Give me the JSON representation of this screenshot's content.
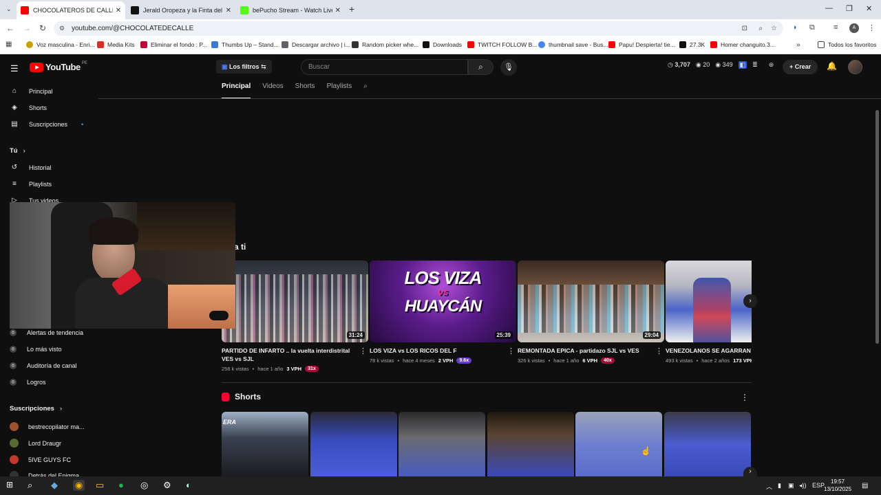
{
  "browser": {
    "tabs": [
      {
        "title": "CHOCOLATEROS DE CALLE - Yo",
        "active": true,
        "icon": "youtube-favicon",
        "color": "#ff0000"
      },
      {
        "title": "Jerald Oropeza y la Finta del Sh",
        "active": false,
        "icon": "tiktok-favicon",
        "color": "#111111"
      },
      {
        "title": "bePucho Stream - Watch Live o",
        "active": false,
        "icon": "kick-favicon",
        "color": "#53fc18"
      }
    ],
    "url": "youtube.com/@CHOCOLATEDECALLE",
    "bookmarks": [
      {
        "label": "Voz masculina - Enri...",
        "color": "#c8a000"
      },
      {
        "label": "Media Kits",
        "color": "#d93025"
      },
      {
        "label": "Eliminar el fondo : P...",
        "color": "#c00033"
      },
      {
        "label": "Thumbs Up – Stand...",
        "color": "#3a7bd5"
      },
      {
        "label": "Descargar archivo | i...",
        "color": "#5f6368"
      },
      {
        "label": "Random picker whe...",
        "color": "#333333"
      },
      {
        "label": "Downloads",
        "color": "#111111"
      },
      {
        "label": "TWITCH FOLLOW B...",
        "color": "#ff0000"
      },
      {
        "label": "thumbnail save - Bus...",
        "color": "#4285f4"
      },
      {
        "label": "Papu! Despierta! tie...",
        "color": "#ff0000"
      },
      {
        "label": "27.3K",
        "color": "#111111"
      },
      {
        "label": "Homer changuito.3...",
        "color": "#ff0000"
      }
    ],
    "all_bookmarks": "Todos los favoritos"
  },
  "youtube": {
    "logo": "YouTube",
    "country": "PE",
    "filters_label": "Los filtros",
    "search_placeholder": "Buscar",
    "stats": {
      "a": "3,707",
      "b": "20",
      "c": "349"
    },
    "create_label": "Crear",
    "sidebar": {
      "main": [
        "Principal",
        "Shorts",
        "Suscripciones"
      ],
      "you_header": "Tú",
      "you": [
        "Historial",
        "Playlists",
        "Tus videos"
      ],
      "tools": [
        "Alertas de tendencia",
        "Lo más visto",
        "Auditoría de canal",
        "Logros"
      ],
      "subs_header": "Suscripciones",
      "subs": [
        "bestrecopilator ma...",
        "Lord Draugr",
        "5IVE GUYS FC",
        "Detrás del Enigma"
      ]
    },
    "channel_tabs": [
      "Principal",
      "Videos",
      "Shorts",
      "Playlists"
    ],
    "section_title": "a ti",
    "videos": [
      {
        "title": "PARTIDO DE INFARTO .. la vuelta interdistrital VES vs SJL",
        "duration": "31:24",
        "views": "256 k vistas",
        "age": "hace 1 año",
        "vph": "3 VPH",
        "mult": "31x"
      },
      {
        "title": "LOS VIZA vs LOS RICOS DEL F",
        "duration": "25:39",
        "views": "78 k vistas",
        "age": "hace 4 meses",
        "vph": "2 VPH",
        "mult": "9.6x"
      },
      {
        "title": "REMONTADA EPICA - partidazo SJL vs VES",
        "duration": "29:04",
        "views": "326 k vistas",
        "age": "hace 1 año",
        "vph": "6 VPH",
        "mult": "40x"
      },
      {
        "title": "VENEZOLANOS SE AGARRAN CON",
        "duration": "",
        "views": "493 k vistas",
        "age": "hace 2 años",
        "vph": "173 VPH",
        "mult": ""
      }
    ],
    "thumb_text": {
      "line1": "LOS VIZA",
      "vs": "VS",
      "line2": "HUAYCÁN"
    },
    "shorts_title": "Shorts"
  },
  "taskbar": {
    "lang": "ESP",
    "time": "19:57",
    "date": "13/10/2025"
  }
}
